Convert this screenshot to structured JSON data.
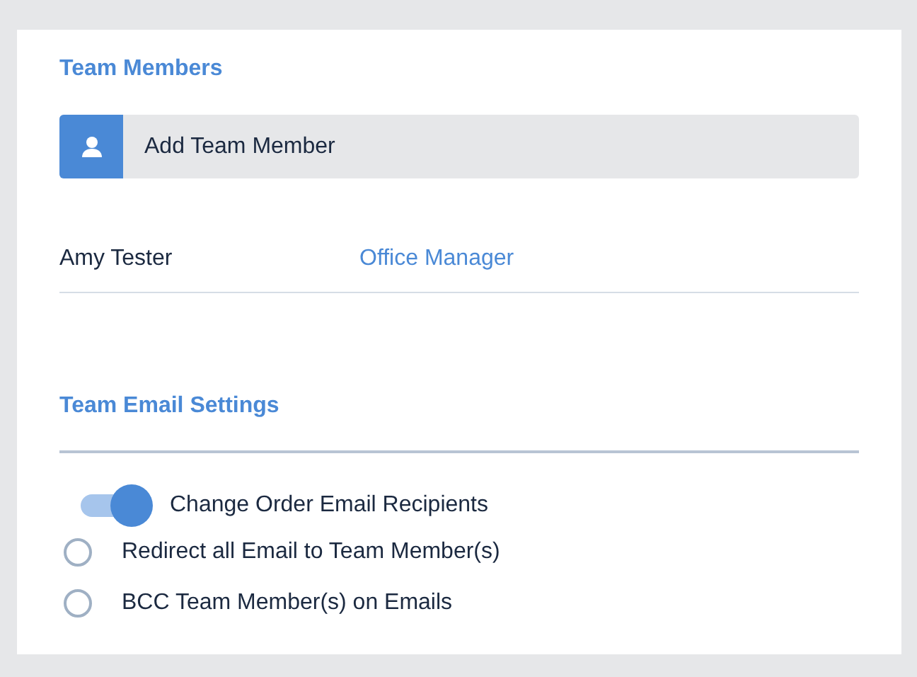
{
  "team_members": {
    "heading": "Team Members",
    "add_button": "Add Team Member",
    "members": [
      {
        "name": "Amy Tester",
        "role": "Office Manager"
      }
    ]
  },
  "email_settings": {
    "heading": "Team Email Settings",
    "toggle": {
      "label": "Change Order Email Recipients",
      "on": true
    },
    "options": [
      {
        "label": "Redirect all Email to Team Member(s)",
        "selected": false
      },
      {
        "label": "BCC Team Member(s) on Emails",
        "selected": false
      }
    ]
  }
}
